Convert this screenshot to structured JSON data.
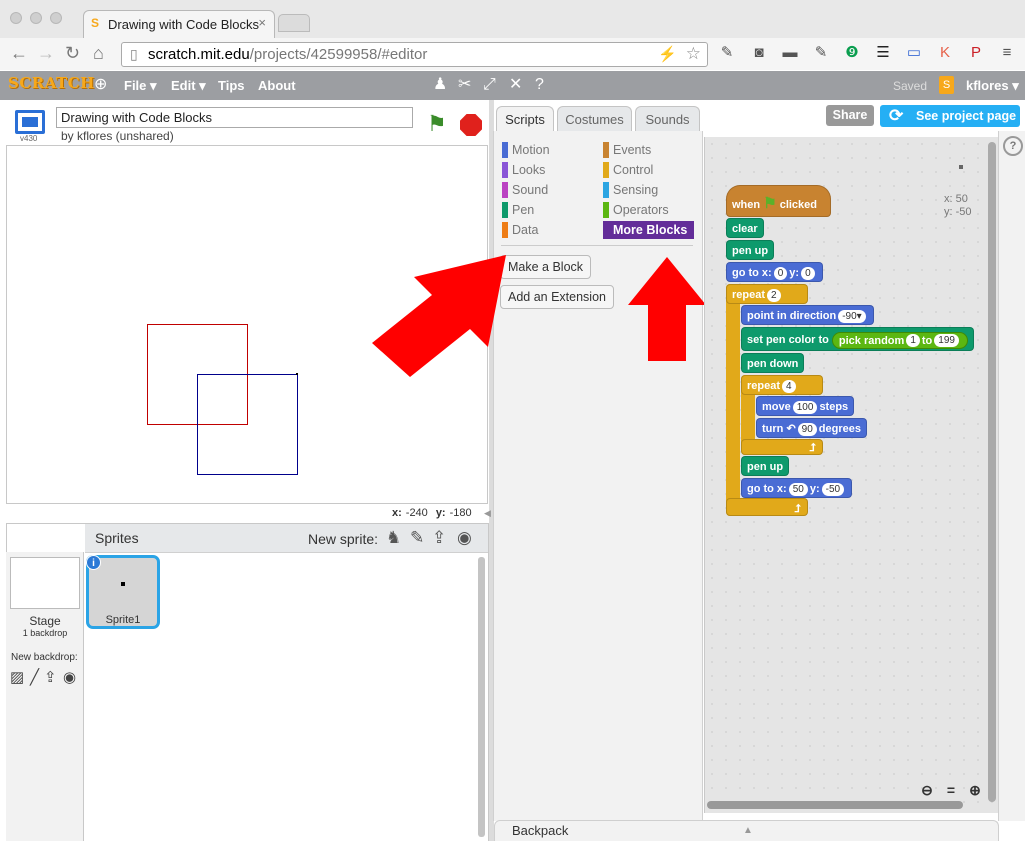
{
  "browser": {
    "tab_title": "Drawing with Code Blocks",
    "url_host": "scratch.mit.edu",
    "url_path": "/projects/42599958/#editor"
  },
  "menu": {
    "logo": "SCRATCH",
    "file": "File ▾",
    "edit": "Edit ▾",
    "tips": "Tips",
    "about": "About",
    "saved": "Saved",
    "user": "kflores ▾"
  },
  "stage": {
    "title": "Drawing with Code Blocks",
    "owner": "by kflores (unshared)",
    "version": "v430",
    "x_label": "x:",
    "x_value": "-240",
    "y_label": "y:",
    "y_value": "-180"
  },
  "tabs": {
    "scripts": "Scripts",
    "costumes": "Costumes",
    "sounds": "Sounds"
  },
  "header_buttons": {
    "share": "Share",
    "see_project": "See project page"
  },
  "categories": [
    {
      "label": "Motion",
      "color": "#4a6cd4"
    },
    {
      "label": "Looks",
      "color": "#8a55d7"
    },
    {
      "label": "Sound",
      "color": "#bb42c3"
    },
    {
      "label": "Pen",
      "color": "#0e9a6c"
    },
    {
      "label": "Data",
      "color": "#ee7d16"
    },
    {
      "label": "Events",
      "color": "#c88330"
    },
    {
      "label": "Control",
      "color": "#e1a91a"
    },
    {
      "label": "Sensing",
      "color": "#2ca5e2"
    },
    {
      "label": "Operators",
      "color": "#5cb712"
    },
    {
      "label": "More Blocks",
      "color": "#632d99"
    }
  ],
  "palette_buttons": {
    "make_block": "Make a Block",
    "add_extension": "Add an Extension"
  },
  "script": {
    "when": "when",
    "clicked": "clicked",
    "clear": "clear",
    "pen_up": "pen up",
    "go_to": "go to x:",
    "x1": "0",
    "y_lbl": "y:",
    "y1": "0",
    "repeat": "repeat",
    "repeat_outer": "2",
    "point_in_direction": "point in direction",
    "direction": "-90▾",
    "set_pen_color": "set pen color to",
    "pick_random": "pick random",
    "rand_from": "1",
    "to": "to",
    "rand_to": "199",
    "pen_down": "pen down",
    "repeat_inner": "4",
    "move": "move",
    "steps_val": "100",
    "steps": "steps",
    "turn": "turn",
    "turn_val": "90",
    "degrees": "degrees",
    "pen_up2": "pen up",
    "go_to2": "go to x:",
    "x2": "50",
    "y2": "-50"
  },
  "sprite_position": {
    "x": "x: 50",
    "y": "y: -50"
  },
  "sprites_panel": {
    "title": "Sprites",
    "new_sprite": "New sprite:",
    "stage_label": "Stage",
    "backdrop_count": "1 backdrop",
    "new_backdrop": "New backdrop:",
    "sprite1": "Sprite1"
  },
  "backpack": "Backpack",
  "colors": {
    "accent": "#25aff4",
    "more_blocks": "#632d99",
    "arrow": "#ff0000",
    "square_red": "#c00000",
    "square_blue": "#00008b"
  }
}
